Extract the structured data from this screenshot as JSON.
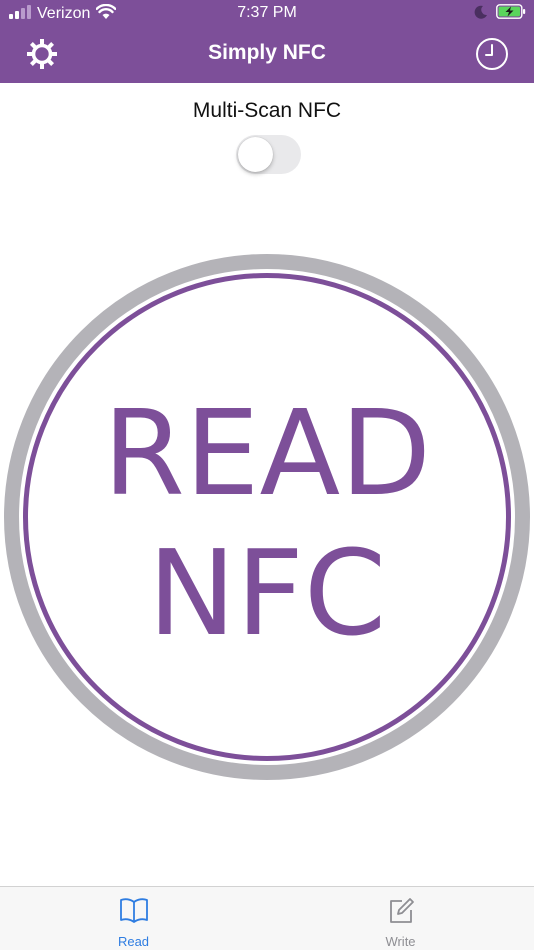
{
  "status_bar": {
    "carrier": "Verizon",
    "time": "7:37 PM",
    "icons": [
      "signal-icon",
      "wifi-icon",
      "moon-icon",
      "battery-charging-icon"
    ]
  },
  "nav": {
    "title": "Simply NFC",
    "left_icon": "gear-icon",
    "right_icon": "clock-icon"
  },
  "multi_scan": {
    "label": "Multi-Scan NFC",
    "enabled": false
  },
  "read_button": {
    "line1": "READ",
    "line2": "NFC"
  },
  "tabs": [
    {
      "label": "Read",
      "icon": "book-icon",
      "selected": true
    },
    {
      "label": "Write",
      "icon": "edit-icon",
      "selected": false
    }
  ],
  "colors": {
    "accent": "#7d4f99",
    "ring": "#b4b3b8",
    "tab_selected": "#2f7de1",
    "tab_unselected": "#8e8e93",
    "toggle_off": "#e9e9eb"
  }
}
